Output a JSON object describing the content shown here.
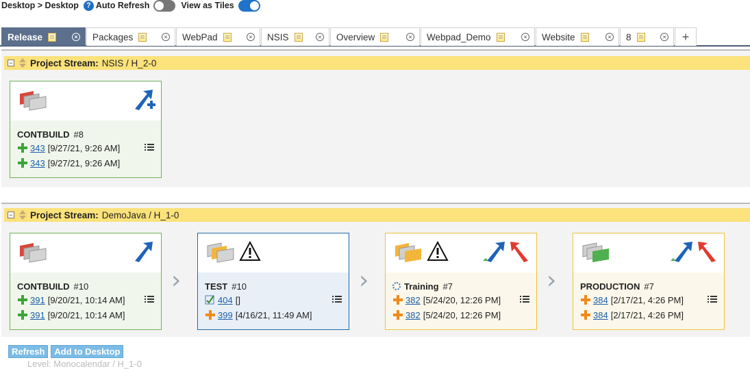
{
  "topbar": {
    "breadcrumb": "Desktop > Desktop",
    "auto_refresh_label": "Auto Refresh",
    "auto_refresh_on": false,
    "view_tiles_label": "View as Tiles",
    "view_tiles_on": true
  },
  "tabs": [
    {
      "label": "Release",
      "active": true
    },
    {
      "label": "Packages"
    },
    {
      "label": "WebPad"
    },
    {
      "label": "NSIS"
    },
    {
      "label": "Overview"
    },
    {
      "label": "Webpad_Demo"
    },
    {
      "label": "Website"
    },
    {
      "label": "8"
    }
  ],
  "add_tab_label": "+",
  "streams": [
    {
      "label": "Project Stream:",
      "name": "NSIS / H_2-0",
      "cards": [
        {
          "stage": "CONTBUILD",
          "number": "#8",
          "rows": [
            {
              "link": "343",
              "text": "[9/27/21, 9:26 AM]"
            },
            {
              "link": "343",
              "text": "[9/27/21, 9:26 AM]"
            }
          ]
        }
      ]
    },
    {
      "label": "Project Stream:",
      "name": "DemoJava / H_1-0",
      "cards": [
        {
          "stage": "CONTBUILD",
          "number": "#10",
          "rows": [
            {
              "link": "391",
              "text": "[9/20/21, 10:14 AM]"
            },
            {
              "link": "391",
              "text": "[9/20/21, 10:14 AM]"
            }
          ]
        },
        {
          "stage": "TEST",
          "number": "#10",
          "rows": [
            {
              "link": "404",
              "text": "[]"
            },
            {
              "link": "399",
              "text": "[4/16/21, 11:49 AM]"
            }
          ]
        },
        {
          "stage": "Training",
          "number": "#7",
          "rows": [
            {
              "link": "382",
              "text": "[5/24/20, 12:26 PM]"
            },
            {
              "link": "382",
              "text": "[5/24/20, 12:26 PM]"
            }
          ]
        },
        {
          "stage": "PRODUCTION",
          "number": "#7",
          "rows": [
            {
              "link": "384",
              "text": "[2/17/21, 4:26 PM]"
            },
            {
              "link": "384",
              "text": "[2/17/21, 4:26 PM]"
            }
          ]
        }
      ]
    }
  ],
  "buttons": {
    "refresh": "Refresh",
    "add_to_desktop": "Add to Desktop"
  },
  "faded_text": "Level: Monocalendar / H_1-0",
  "colors": {
    "tab_active": "#5c6f8c",
    "stream_header": "#fbe27a",
    "link": "#1a5fa8",
    "button": "#7cbbe6"
  }
}
